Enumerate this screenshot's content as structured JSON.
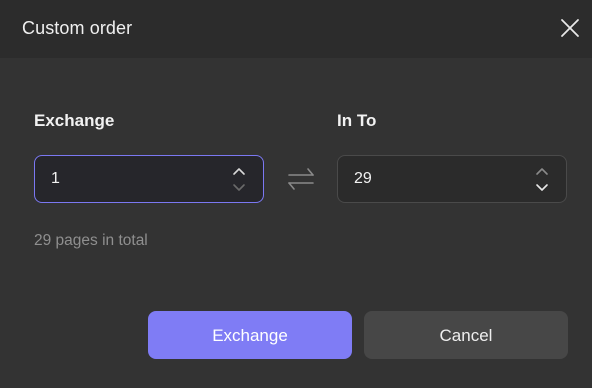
{
  "dialog": {
    "title": "Custom order",
    "close_icon": "close-icon"
  },
  "exchange": {
    "label": "Exchange",
    "value": "1"
  },
  "swap_icon": "swap-arrows-icon",
  "in_to": {
    "label": "In To",
    "value": "29"
  },
  "total_text": "29 pages in total",
  "buttons": {
    "exchange_label": "Exchange",
    "cancel_label": "Cancel"
  },
  "colors": {
    "accent": "#7f7cf5",
    "background": "#333333"
  }
}
